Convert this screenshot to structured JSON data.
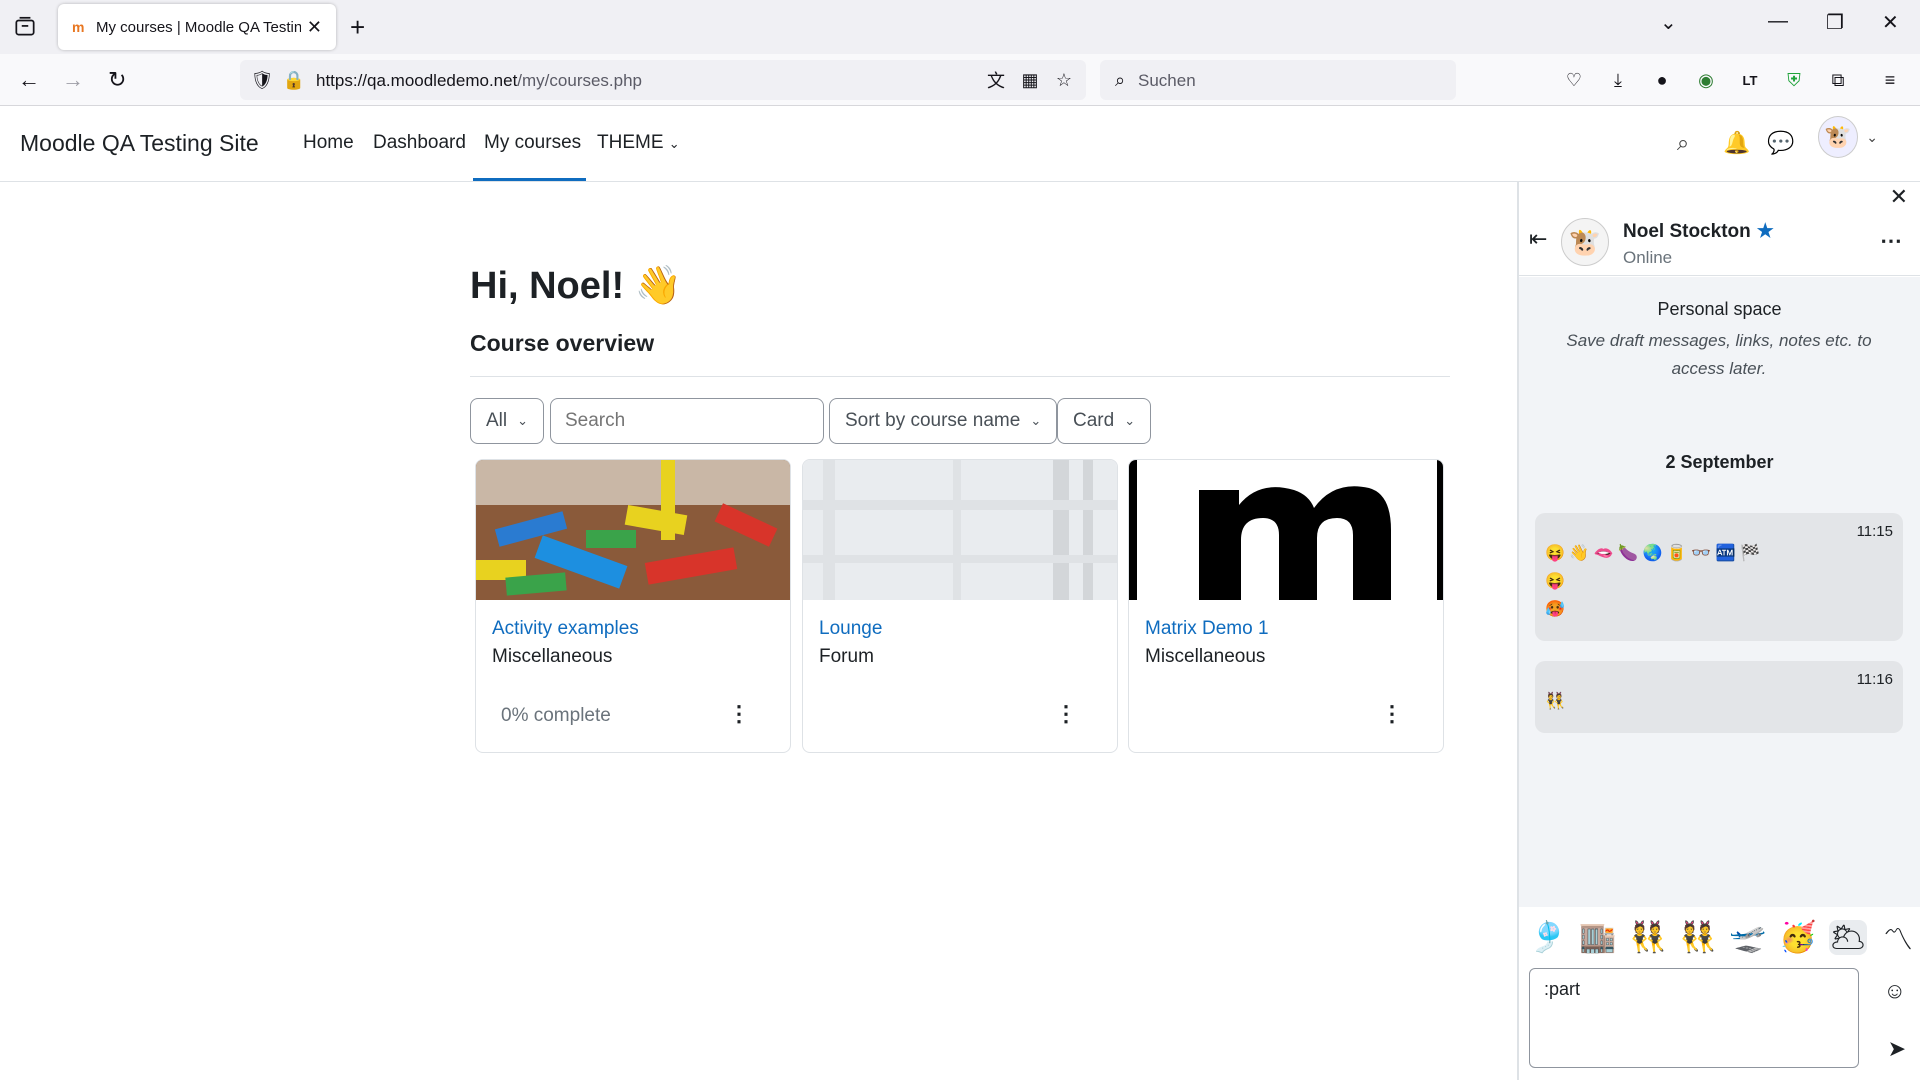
{
  "browser": {
    "tab_title": "My courses | Moodle QA Testing",
    "url_host": "https://qa.moodledemo.net",
    "url_path": "/my/courses.php",
    "search_placeholder": "Suchen"
  },
  "site": {
    "name": "Moodle QA Testing Site",
    "nav": [
      "Home",
      "Dashboard",
      "My courses",
      "THEME"
    ],
    "active_nav": "My courses"
  },
  "main": {
    "greeting": "Hi, Noel! 👋",
    "section_title": "Course overview",
    "filters": {
      "grouping": "All",
      "search_placeholder": "Search",
      "sort": "Sort by course name",
      "view": "Card"
    },
    "courses": [
      {
        "name": "Activity examples",
        "category": "Miscellaneous",
        "progress": "0% complete"
      },
      {
        "name": "Lounge",
        "category": "Forum",
        "progress": ""
      },
      {
        "name": "Matrix Demo 1",
        "category": "Miscellaneous",
        "progress": ""
      }
    ]
  },
  "drawer": {
    "contact_name": "Noel Stockton",
    "status": "Online",
    "personal_space_title": "Personal space",
    "personal_space_desc": "Save draft messages, links, notes etc. to access later.",
    "date": "2 September",
    "messages": [
      {
        "time": "11:15",
        "lines": [
          "😝 👋 🫦 🍆 🌏 🥫 👓 🏧 🏁",
          "😝",
          "🥵"
        ]
      },
      {
        "time": "11:16",
        "lines": [
          "👯"
        ]
      }
    ],
    "emoji_suggestions": [
      "🎐",
      "🏬",
      "👯",
      "👯",
      "🛫",
      "🥳",
      "🌥",
      "〽"
    ],
    "compose_value": ":part"
  }
}
